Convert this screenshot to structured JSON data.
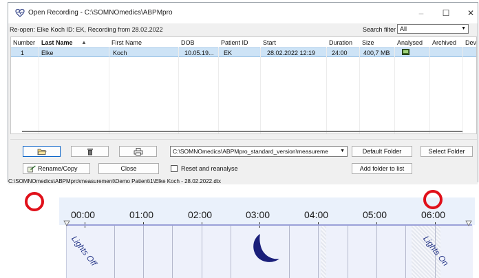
{
  "window": {
    "title": "Open Recording - C:\\SOMNOmedics\\ABPMpro",
    "minimize": "–",
    "maximize": "☐",
    "close": "✕"
  },
  "info": {
    "reopen_text": "Re-open: Elke Koch ID: EK, Recording from 28.02.2022",
    "search_filter_label": "Search filter",
    "search_filter_value": "All"
  },
  "table": {
    "headers": [
      "Number",
      "Last Name",
      "First Name",
      "DOB",
      "Patient ID",
      "Start",
      "Duration",
      "Size",
      "Analysed",
      "Archived",
      "Devi"
    ],
    "sort_indicator": "▲",
    "rows": [
      {
        "number": "1",
        "last_name": "Elke",
        "first_name": "Koch",
        "dob": "10.05.19...",
        "patient_id": "EK",
        "start": "28.02.2022 12:19",
        "duration": "24:00",
        "size": "400,7 MB"
      }
    ]
  },
  "buttons": {
    "open_icon": "open-folder",
    "delete_icon": "trash",
    "print_icon": "printer",
    "rename_copy": "Rename/Copy",
    "close": "Close",
    "default_folder": "Default Folder",
    "select_folder": "Select Folder",
    "add_folder": "Add folder to list"
  },
  "path_combo_value": "C:\\SOMNOmedics\\ABPMpro_standard_version\\measureme",
  "reset_label": "Reset and reanalyse",
  "status_path": "C:\\SOMNOmedics\\ABPMpro\\measurement\\Demo Patient\\1\\Elke Koch - 28.02.2022.dtx",
  "timeline": {
    "hours": [
      "00:00",
      "01:00",
      "02:00",
      "03:00",
      "04:00",
      "05:00",
      "06:00"
    ],
    "lights_off": "Lights Off",
    "lights_on": "Lights On",
    "moon_icon": "moon-icon",
    "accent": "#1a1f7a",
    "marker_color": "#e0101a"
  }
}
